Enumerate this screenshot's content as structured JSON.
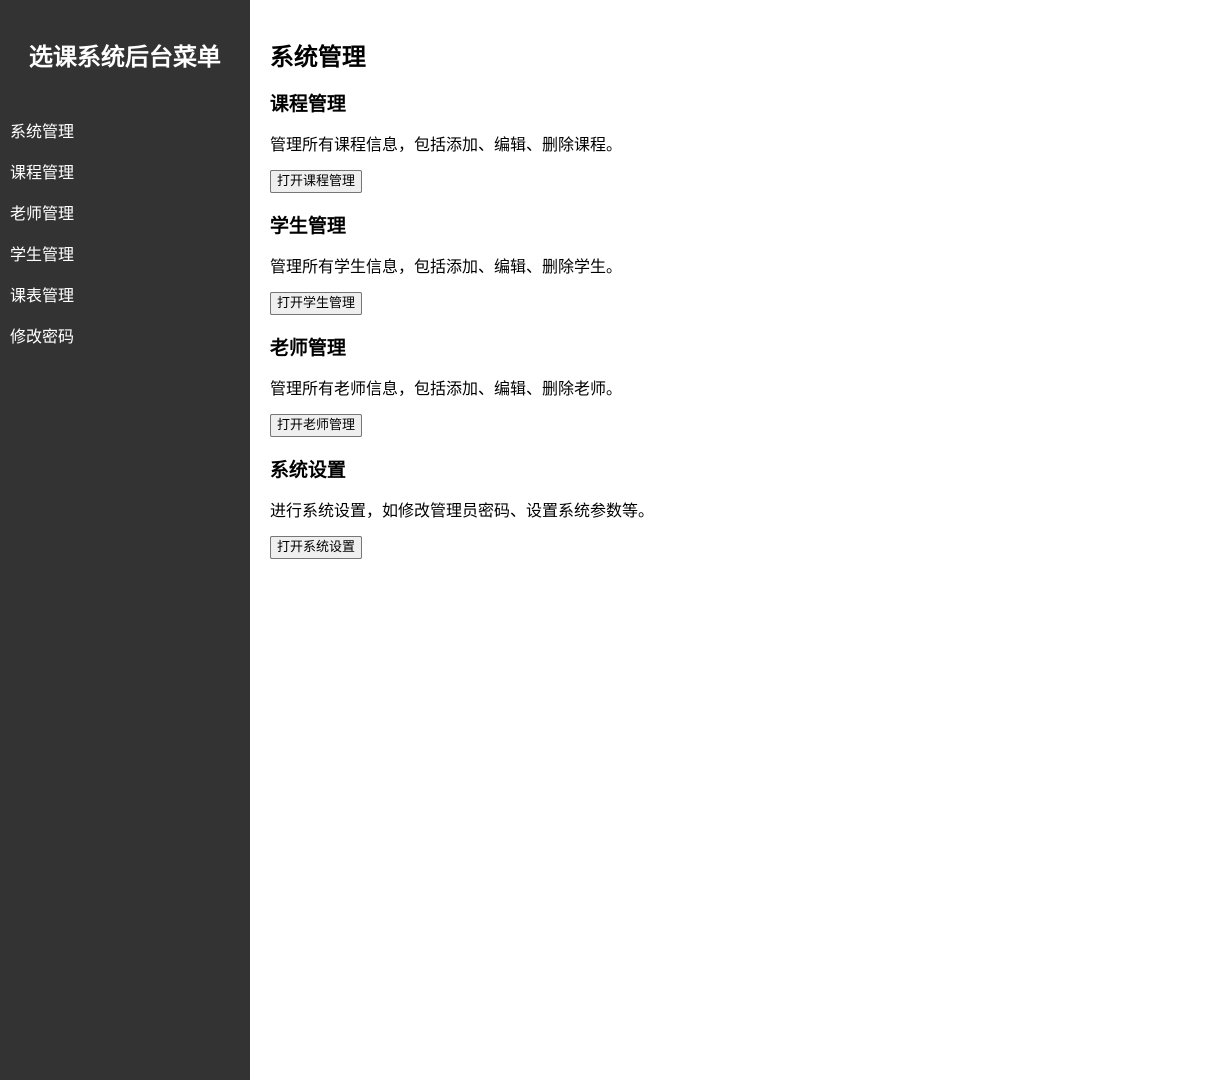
{
  "sidebar": {
    "title": "选课系统后台菜单",
    "items": [
      {
        "label": "系统管理"
      },
      {
        "label": "课程管理"
      },
      {
        "label": "老师管理"
      },
      {
        "label": "学生管理"
      },
      {
        "label": "课表管理"
      },
      {
        "label": "修改密码"
      }
    ]
  },
  "main": {
    "page_title": "系统管理",
    "sections": [
      {
        "title": "课程管理",
        "description": "管理所有课程信息，包括添加、编辑、删除课程。",
        "button_label": "打开课程管理"
      },
      {
        "title": "学生管理",
        "description": "管理所有学生信息，包括添加、编辑、删除学生。",
        "button_label": "打开学生管理"
      },
      {
        "title": "老师管理",
        "description": "管理所有老师信息，包括添加、编辑、删除老师。",
        "button_label": "打开老师管理"
      },
      {
        "title": "系统设置",
        "description": "进行系统设置，如修改管理员密码、设置系统参数等。",
        "button_label": "打开系统设置"
      }
    ]
  },
  "colors": {
    "sidebar_background": "#333333",
    "sidebar_text": "#ffffff",
    "main_background": "#ffffff"
  }
}
